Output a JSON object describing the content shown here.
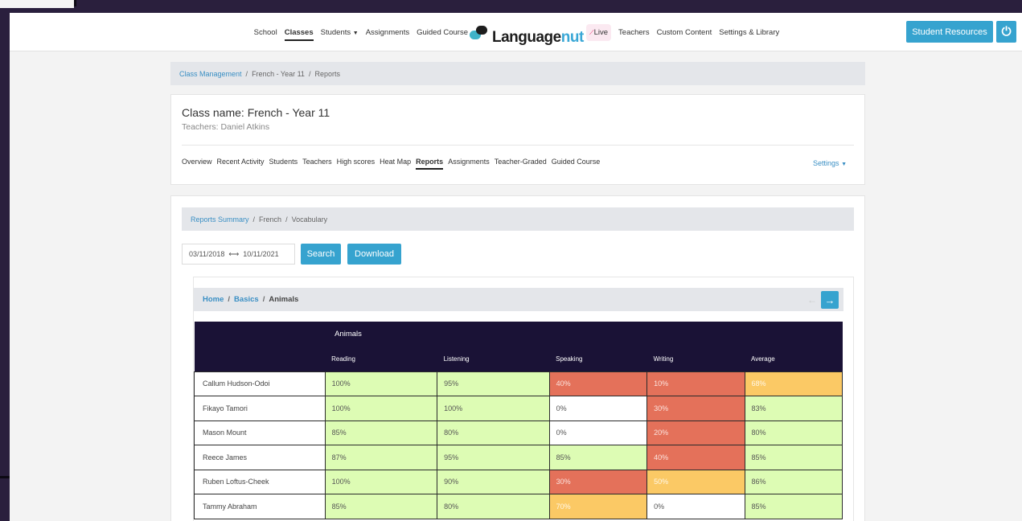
{
  "nav": {
    "left_items": [
      "School",
      "Classes",
      "Students",
      "Assignments",
      "Guided Course"
    ],
    "active": "Classes",
    "logo_main": "Language",
    "logo_accent": "nut",
    "right_items": [
      "Teachers",
      "Custom Content",
      "Settings & Library"
    ],
    "live_label": "Live",
    "student_resources": "Student Resources"
  },
  "breadcrumb": {
    "root": "Class Management",
    "class": "French - Year 11",
    "page": "Reports"
  },
  "class": {
    "name": "Class name: French - Year 11",
    "teachers": "Teachers: Daniel Atkins"
  },
  "tabs": [
    "Overview",
    "Recent Activity",
    "Students",
    "Teachers",
    "High scores",
    "Heat Map",
    "Reports",
    "Assignments",
    "Teacher-Graded",
    "Guided Course"
  ],
  "active_tab": "Reports",
  "settings_label": "Settings",
  "reports": {
    "crumb_root": "Reports Summary",
    "crumb_lang": "French",
    "crumb_section": "Vocabulary",
    "date_from": "03/11/2018",
    "date_to": "10/11/2021",
    "search_label": "Search",
    "download_label": "Download"
  },
  "inner": {
    "home": "Home",
    "basics": "Basics",
    "current": "Animals"
  },
  "table": {
    "group_header": "Animals",
    "columns": [
      "Reading",
      "Listening",
      "Speaking",
      "Writing",
      "Average"
    ],
    "rows": [
      {
        "name": "Callum Hudson-Odoi",
        "values": [
          "100%",
          "95%",
          "40%",
          "10%",
          "68%"
        ],
        "colors": [
          "green",
          "green",
          "red",
          "red",
          "orange"
        ]
      },
      {
        "name": "Fikayo Tamori",
        "values": [
          "100%",
          "100%",
          "0%",
          "30%",
          "83%"
        ],
        "colors": [
          "green",
          "green",
          "white",
          "red",
          "green"
        ]
      },
      {
        "name": "Mason Mount",
        "values": [
          "85%",
          "80%",
          "0%",
          "20%",
          "80%"
        ],
        "colors": [
          "green",
          "green",
          "white",
          "red",
          "green"
        ]
      },
      {
        "name": "Reece James",
        "values": [
          "87%",
          "95%",
          "85%",
          "40%",
          "85%"
        ],
        "colors": [
          "green",
          "green",
          "green",
          "red",
          "green"
        ]
      },
      {
        "name": "Ruben Loftus-Cheek",
        "values": [
          "100%",
          "90%",
          "30%",
          "50%",
          "86%"
        ],
        "colors": [
          "green",
          "green",
          "red",
          "orange",
          "green"
        ]
      },
      {
        "name": "Tammy Abraham",
        "values": [
          "85%",
          "80%",
          "70%",
          "0%",
          "85%"
        ],
        "colors": [
          "green",
          "green",
          "orange",
          "white",
          "green"
        ]
      }
    ]
  },
  "colors": {
    "accent": "#36a3cf",
    "header_dark": "#1a1236",
    "good": "#ddfcb4",
    "bad": "#e4715a",
    "mid": "#fbc965"
  }
}
